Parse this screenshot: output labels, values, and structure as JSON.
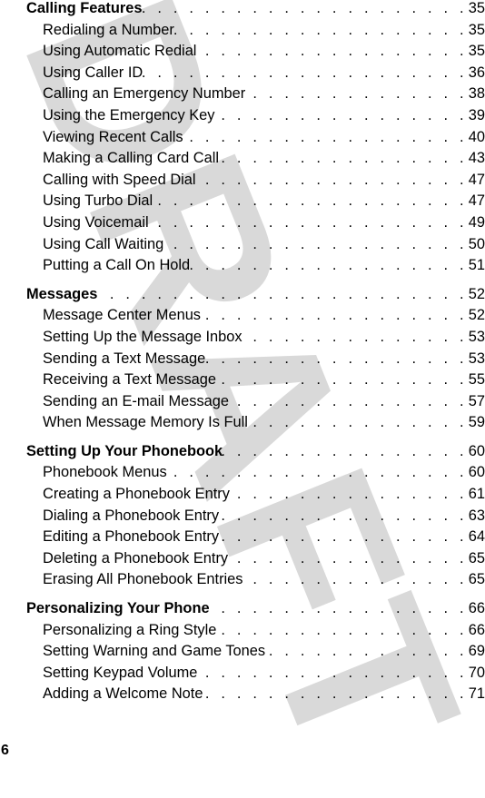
{
  "watermark": "DRAFT",
  "page_number": "6",
  "sections": [
    {
      "title": "Calling Features",
      "page": "35",
      "entries": [
        {
          "title": "Redialing a Number",
          "page": "35"
        },
        {
          "title": "Using Automatic Redial",
          "page": "35"
        },
        {
          "title": "Using Caller ID",
          "page": "36"
        },
        {
          "title": "Calling an Emergency Number",
          "page": "38"
        },
        {
          "title": "Using the Emergency Key",
          "page": "39"
        },
        {
          "title": "Viewing Recent Calls",
          "page": "40"
        },
        {
          "title": "Making a Calling Card Call",
          "page": "43"
        },
        {
          "title": "Calling with Speed Dial",
          "page": "47"
        },
        {
          "title": "Using Turbo Dial",
          "page": "47"
        },
        {
          "title": "Using Voicemail",
          "page": "49"
        },
        {
          "title": "Using Call Waiting",
          "page": "50"
        },
        {
          "title": "Putting a Call On Hold",
          "page": "51"
        }
      ]
    },
    {
      "title": "Messages",
      "page": "52",
      "entries": [
        {
          "title": "Message Center Menus",
          "page": "52"
        },
        {
          "title": "Setting Up the Message Inbox",
          "page": "53"
        },
        {
          "title": "Sending a Text Message",
          "page": "53"
        },
        {
          "title": "Receiving a Text Message",
          "page": "55"
        },
        {
          "title": "Sending an E-mail Message",
          "page": "57"
        },
        {
          "title": "When Message Memory Is Full",
          "page": "59"
        }
      ]
    },
    {
      "title": "Setting Up Your Phonebook",
      "page": "60",
      "entries": [
        {
          "title": "Phonebook Menus",
          "page": "60"
        },
        {
          "title": "Creating a Phonebook Entry",
          "page": "61"
        },
        {
          "title": "Dialing a Phonebook Entry",
          "page": "63"
        },
        {
          "title": "Editing a Phonebook Entry",
          "page": "64"
        },
        {
          "title": "Deleting a Phonebook Entry",
          "page": "65"
        },
        {
          "title": "Erasing All Phonebook Entries",
          "page": "65"
        }
      ]
    },
    {
      "title": "Personalizing Your Phone",
      "page": "66",
      "entries": [
        {
          "title": "Personalizing a Ring Style",
          "page": "66"
        },
        {
          "title": "Setting Warning and Game Tones",
          "page": "69"
        },
        {
          "title": "Setting Keypad Volume",
          "page": "70"
        },
        {
          "title": "Adding a Welcome Note",
          "page": "71"
        }
      ]
    }
  ]
}
